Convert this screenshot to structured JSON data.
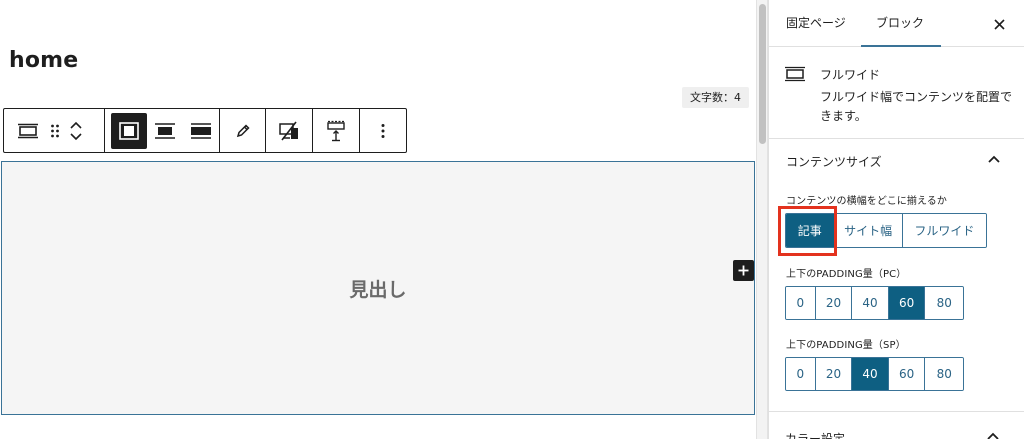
{
  "editor": {
    "page_title": "home",
    "char_count": "文字数：4",
    "block_heading": "見出し"
  },
  "sidebar": {
    "tabs": [
      {
        "label": "固定ページ",
        "active": false
      },
      {
        "label": "ブロック",
        "active": true
      }
    ],
    "block_card": {
      "name": "フルワイド",
      "description": "フルワイド幅でコンテンツを配置できます。"
    },
    "content_size_panel": {
      "title": "コンテンツサイズ",
      "align_label": "コンテンツの横幅をどこに揃えるか",
      "align_options": [
        "記事",
        "サイト幅",
        "フルワイド"
      ],
      "align_selected": "記事",
      "padding_pc_label": "上下のPADDING量（PC）",
      "padding_pc_options": [
        "0",
        "20",
        "40",
        "60",
        "80"
      ],
      "padding_pc_selected": "60",
      "padding_sp_label": "上下のPADDING量（SP）",
      "padding_sp_options": [
        "0",
        "20",
        "40",
        "60",
        "80"
      ],
      "padding_sp_selected": "40"
    },
    "color_panel": {
      "title": "カラー設定"
    }
  },
  "colors": {
    "accent": "#0e5f82",
    "block_border": "#3a7397",
    "highlight": "#e3321e",
    "toolbar_active": "#1e1e1e"
  }
}
